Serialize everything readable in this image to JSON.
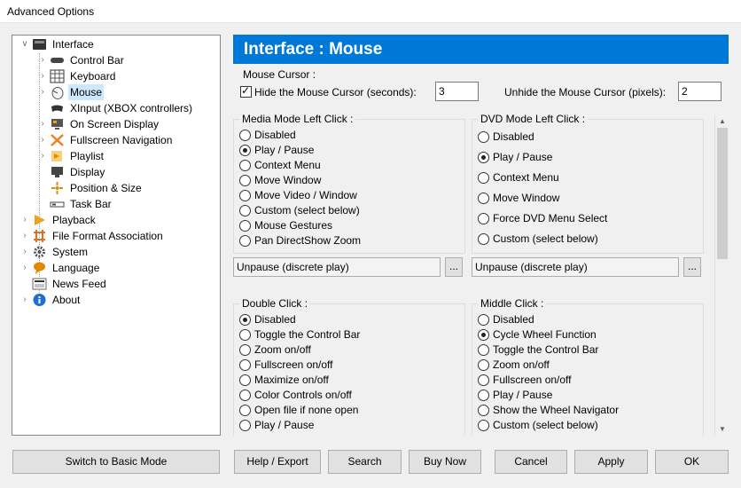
{
  "window": {
    "title": "Advanced Options"
  },
  "tree": {
    "items": [
      {
        "label": "Interface",
        "icon": "interface-icon"
      },
      {
        "label": "Control Bar",
        "icon": "control-bar-icon"
      },
      {
        "label": "Keyboard",
        "icon": "keyboard-icon"
      },
      {
        "label": "Mouse",
        "icon": "mouse-icon"
      },
      {
        "label": "XInput (XBOX controllers)",
        "icon": "gamepad-icon"
      },
      {
        "label": "On Screen Display",
        "icon": "osd-icon"
      },
      {
        "label": "Fullscreen Navigation",
        "icon": "fullscreen-icon"
      },
      {
        "label": "Playlist",
        "icon": "playlist-icon"
      },
      {
        "label": "Display",
        "icon": "display-icon"
      },
      {
        "label": "Position & Size",
        "icon": "position-icon"
      },
      {
        "label": "Task Bar",
        "icon": "taskbar-icon"
      },
      {
        "label": "Playback",
        "icon": "playback-icon"
      },
      {
        "label": "File Format Association",
        "icon": "file-format-icon"
      },
      {
        "label": "System",
        "icon": "gear-icon"
      },
      {
        "label": "Language",
        "icon": "language-icon"
      },
      {
        "label": "News Feed",
        "icon": "news-icon"
      },
      {
        "label": "About",
        "icon": "info-icon"
      }
    ]
  },
  "header": {
    "title": "Interface : Mouse"
  },
  "mouse_cursor": {
    "title": "Mouse Cursor :",
    "hide_label": "Hide the Mouse Cursor (seconds):",
    "hide_value": "3",
    "unhide_label": "Unhide the Mouse Cursor (pixels):",
    "unhide_value": "2"
  },
  "media_left": {
    "title": "Media Mode Left Click :",
    "options": [
      "Disabled",
      "Play / Pause",
      "Context Menu",
      "Move Window",
      "Move Video / Window",
      "Custom (select below)",
      "Mouse Gestures",
      "Pan DirectShow Zoom"
    ],
    "selected": "Play / Pause",
    "custom_value": "Unpause (discrete play)"
  },
  "dvd_left": {
    "title": "DVD Mode Left Click :",
    "options": [
      "Disabled",
      "Play / Pause",
      "Context Menu",
      "Move Window",
      "Force DVD Menu Select",
      "Custom (select below)"
    ],
    "selected": "Play / Pause",
    "custom_value": "Unpause (discrete play)"
  },
  "double_click": {
    "title": "Double Click :",
    "options": [
      "Disabled",
      "Toggle the Control Bar",
      "Zoom on/off",
      "Fullscreen on/off",
      "Maximize on/off",
      "Color Controls on/off",
      "Open file if none open",
      "Play / Pause"
    ],
    "selected": "Disabled"
  },
  "middle_click": {
    "title": "Middle Click :",
    "options": [
      "Disabled",
      "Cycle Wheel Function",
      "Toggle the Control Bar",
      "Zoom on/off",
      "Fullscreen on/off",
      "Play / Pause",
      "Show the Wheel Navigator",
      "Custom (select below)"
    ],
    "selected": "Cycle Wheel Function"
  },
  "ellipsis": "...",
  "buttons": {
    "basic_mode": "Switch to Basic Mode",
    "help": "Help / Export",
    "search": "Search",
    "buy": "Buy Now",
    "cancel": "Cancel",
    "apply": "Apply",
    "ok": "OK"
  },
  "colors": {
    "accent": "#0078d7",
    "selection": "#cce8ff"
  }
}
